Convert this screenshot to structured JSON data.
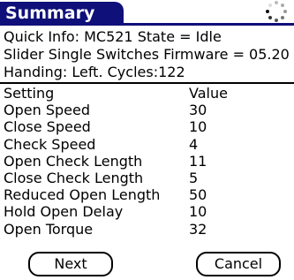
{
  "title": "Summary",
  "busy_icon": "spinner-icon",
  "info": {
    "line1": "Quick Info: MC521 State = Idle",
    "line2": "Slider Single Switches Firmware = 05.20",
    "line3": "Handing: Left. Cycles:122"
  },
  "table": {
    "headers": [
      "Setting",
      "Value"
    ],
    "rows": [
      {
        "setting": "Open Speed",
        "value": "30"
      },
      {
        "setting": "Close Speed",
        "value": "10"
      },
      {
        "setting": "Check Speed",
        "value": "4"
      },
      {
        "setting": "Open Check Length",
        "value": "11"
      },
      {
        "setting": "Close Check Length",
        "value": "5"
      },
      {
        "setting": "Reduced Open Length",
        "value": "50"
      },
      {
        "setting": "Hold Open Delay",
        "value": "10"
      },
      {
        "setting": "Open Torque",
        "value": "32"
      }
    ]
  },
  "buttons": {
    "next": "Next",
    "cancel": "Cancel"
  },
  "colors": {
    "title_bg": "#10107a",
    "title_text": "#ffffff"
  }
}
